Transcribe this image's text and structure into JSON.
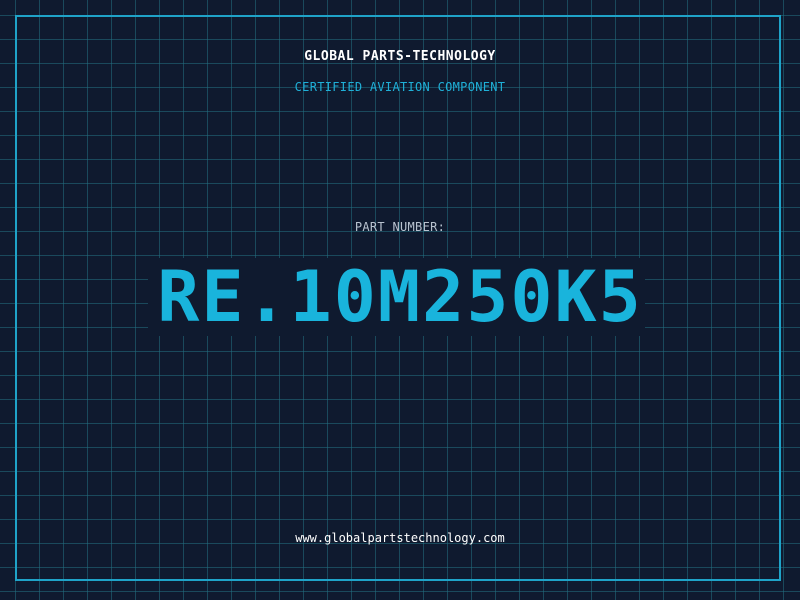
{
  "header": {
    "company": "GLOBAL PARTS-TECHNOLOGY",
    "tagline": "CERTIFIED AVIATION COMPONENT"
  },
  "part": {
    "label": "PART NUMBER:",
    "number": "RE.10M250K5"
  },
  "footer": {
    "website": "www.globalpartstechnology.com"
  },
  "colors": {
    "background": "#0f1a2f",
    "grid": "#226f82",
    "frame": "#1fa3c8",
    "accent": "#19b4dc",
    "text": "#ffffff",
    "muted": "#b8c2cf"
  }
}
